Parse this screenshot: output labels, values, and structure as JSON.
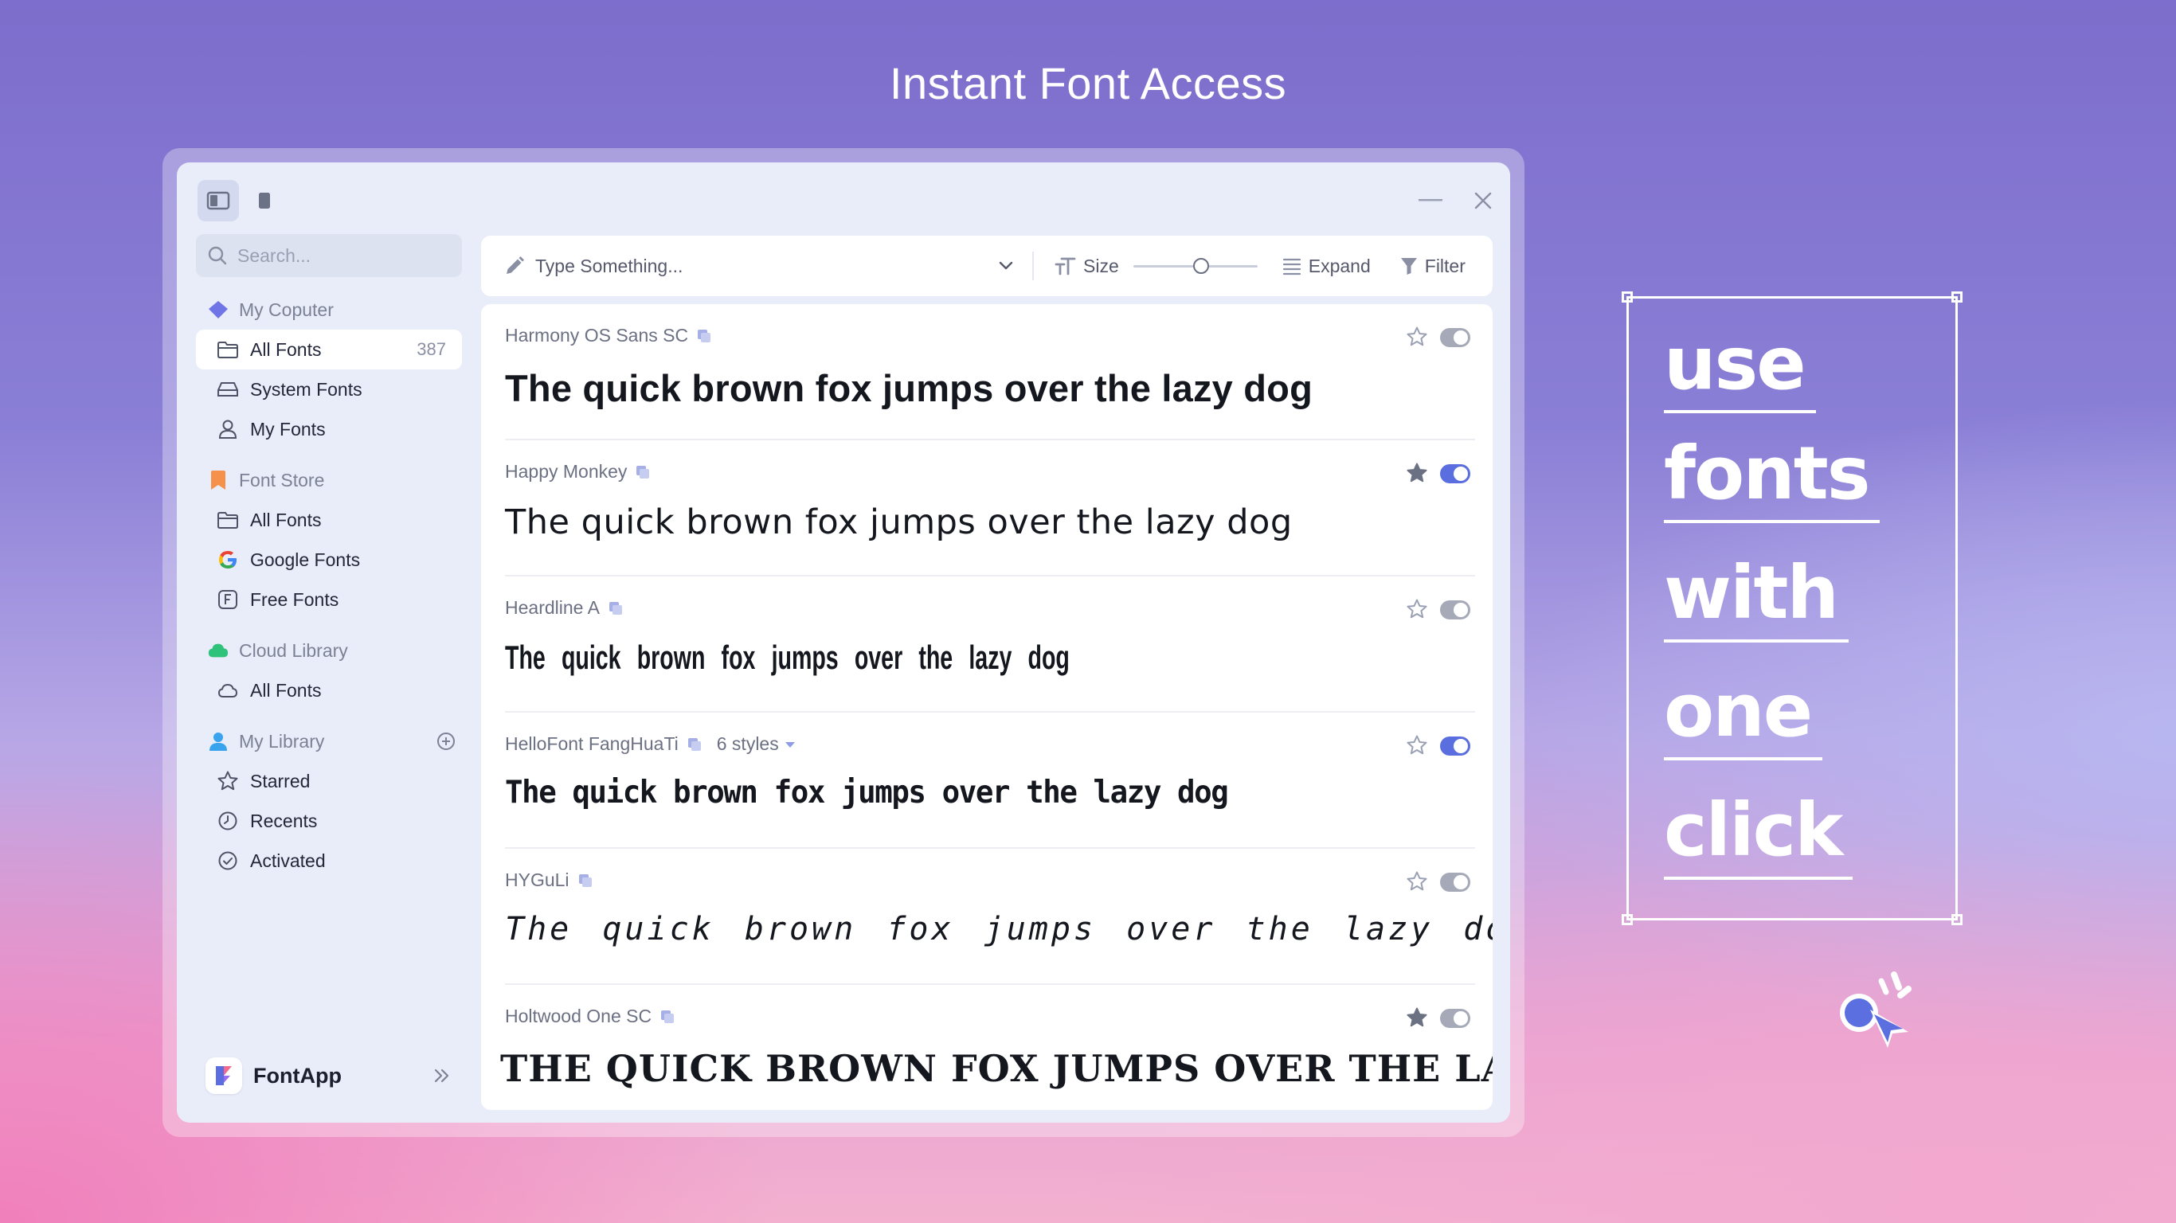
{
  "headline": "Instant Font Access",
  "search": {
    "placeholder": "Search..."
  },
  "sidebar": {
    "my_computer": {
      "label": "My Coputer",
      "items": [
        {
          "label": "All Fonts",
          "count": "387"
        },
        {
          "label": "System Fonts"
        },
        {
          "label": "My Fonts"
        }
      ]
    },
    "font_store": {
      "label": "Font Store",
      "items": [
        {
          "label": "All Fonts"
        },
        {
          "label": "Google Fonts"
        },
        {
          "label": "Free Fonts"
        }
      ]
    },
    "cloud_library": {
      "label": "Cloud Library",
      "items": [
        {
          "label": "All Fonts"
        }
      ]
    },
    "my_library": {
      "label": "My Library",
      "items": [
        {
          "label": "Starred"
        },
        {
          "label": "Recents"
        },
        {
          "label": "Activated"
        }
      ]
    }
  },
  "brand": {
    "name": "FontApp"
  },
  "toolbar": {
    "input_placeholder": "Type Something...",
    "size_label": "Size",
    "size_level": 0.55,
    "expand_label": "Expand",
    "filter_label": "Filter"
  },
  "fonts": [
    {
      "name": "Harmony OS Sans SC",
      "sample": "The quick brown fox jumps over the lazy dog",
      "starred": false,
      "active": false
    },
    {
      "name": "Happy Monkey",
      "sample": "The quick brown fox jumps over the lazy dog",
      "starred": true,
      "active": true
    },
    {
      "name": "Heardline A",
      "sample": "The quick brown fox jumps over the lazy dog",
      "starred": false,
      "active": false
    },
    {
      "name": "HelloFont FangHuaTi",
      "styles": "6 styles",
      "sample": "The quick brown fox jumps over the lazy dog",
      "starred": false,
      "active": true
    },
    {
      "name": "HYGuLi",
      "sample": "The quick brown fox jumps over the lazy dog",
      "starred": false,
      "active": false
    },
    {
      "name": "Holtwood One SC",
      "sample": "The quick brown fox jumps over the lazy dog",
      "starred": true,
      "active": false
    }
  ],
  "decoration": {
    "lines": [
      "use",
      "fonts",
      "with",
      "one",
      "click"
    ]
  },
  "colors": {
    "accent": "#5a6ee0",
    "toggle_off": "#a6aab8",
    "window_bg": "#e9edf9"
  }
}
